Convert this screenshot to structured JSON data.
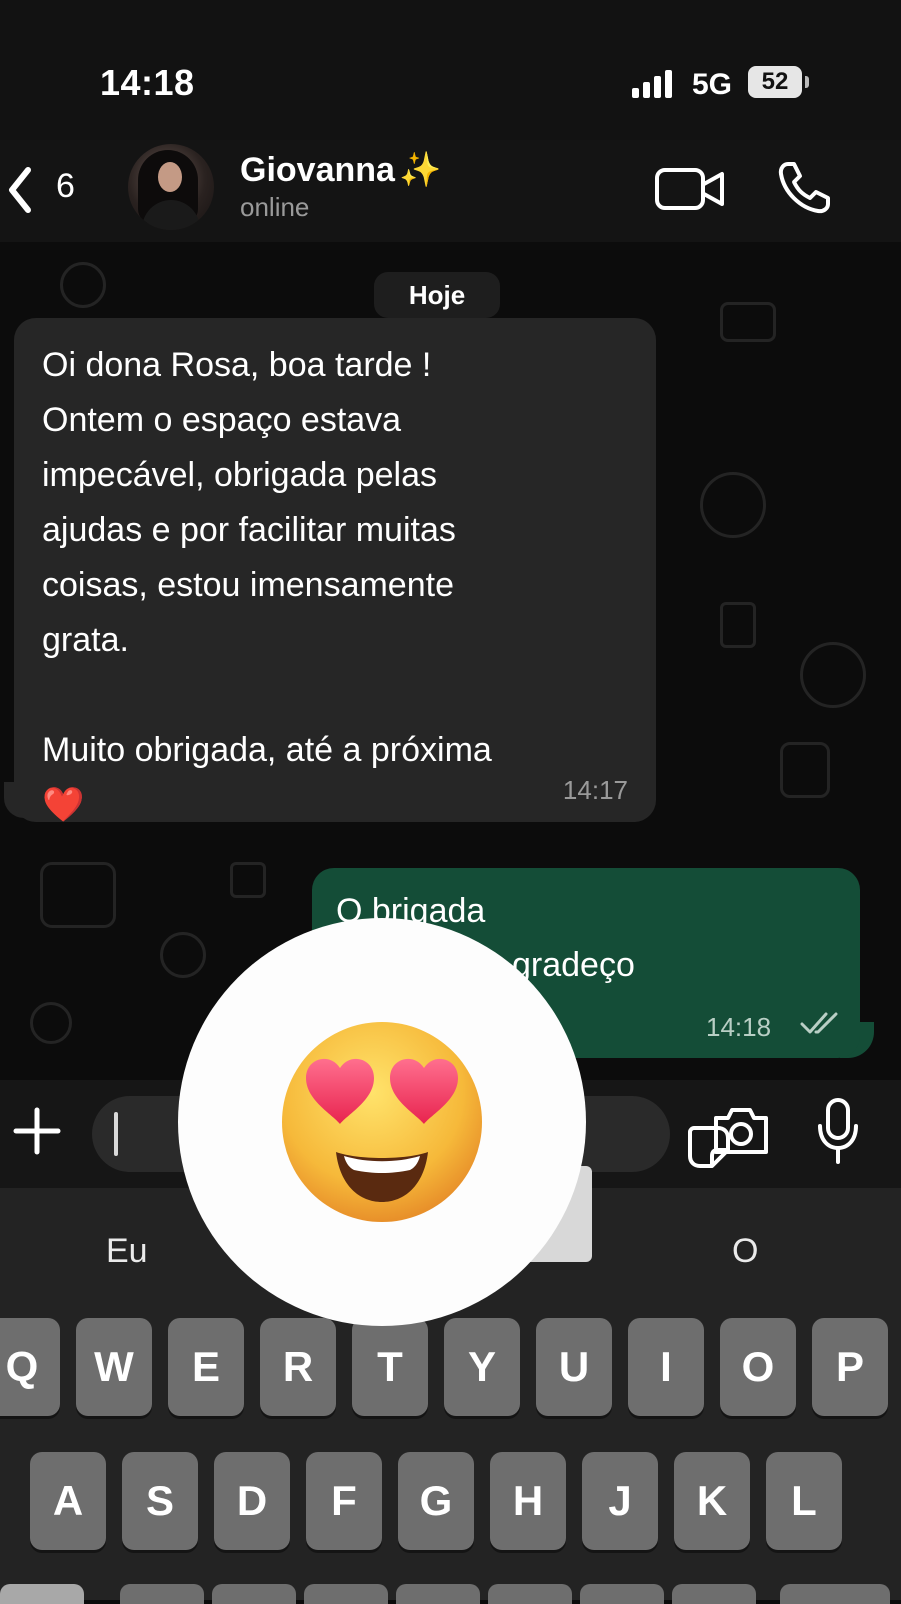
{
  "status_bar": {
    "time": "14:18",
    "network": "5G",
    "battery": "52"
  },
  "header": {
    "back_count": "6",
    "contact_name": "Giovanna",
    "contact_emoji": "✨",
    "contact_status": "online",
    "icons": [
      "back-chevron-icon",
      "video-call-icon",
      "phone-call-icon"
    ]
  },
  "chat": {
    "date_chip": "Hoje",
    "incoming": {
      "text": "Oi dona Rosa, boa tarde !\nOntem o espaço estava\nimpecável, obrigada pelas\najudas e por facilitar muitas\ncoisas, estou imensamente\ngrata.\n\nMuito obrigada, até a próxima\n❤️",
      "time": "14:17"
    },
    "outgoing": {
      "line1": "O brigada",
      "line2": "gradeço",
      "time": "14:18",
      "status": "read"
    }
  },
  "input_bar": {
    "icons": [
      "plus-icon",
      "sticker-icon",
      "camera-icon",
      "microphone-icon"
    ]
  },
  "keyboard": {
    "suggestions": [
      "Eu",
      "O"
    ],
    "row1": [
      "Q",
      "W",
      "E",
      "R",
      "T",
      "Y",
      "U",
      "I",
      "O",
      "P"
    ],
    "row2": [
      "A",
      "S",
      "D",
      "F",
      "G",
      "H",
      "J",
      "K",
      "L"
    ]
  },
  "emoji_popup": {
    "emoji": "heart-eyes-smiling-face"
  },
  "colors": {
    "incoming_bubble": "#262626",
    "outgoing_bubble": "#144d37",
    "key": "#6e6e6e",
    "keyboard_bg": "#232323"
  }
}
